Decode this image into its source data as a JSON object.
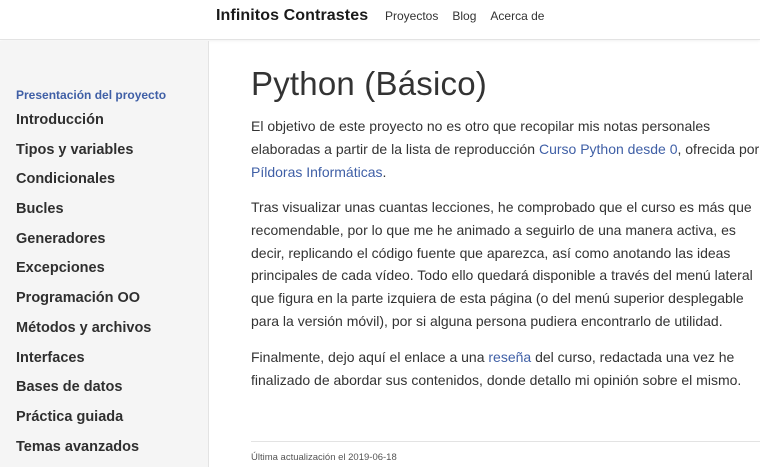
{
  "header": {
    "brand": "Infinitos Contrastes",
    "nav": [
      "Proyectos",
      "Blog",
      "Acerca de"
    ]
  },
  "sidebar": {
    "active_item": "Presentación del proyecto",
    "items": [
      "Introducción",
      "Tipos y variables",
      "Condicionales",
      "Bucles",
      "Generadores",
      "Excepciones",
      "Programación OO",
      "Métodos y archivos",
      "Interfaces",
      "Bases de datos",
      "Práctica guiada",
      "Temas avanzados"
    ]
  },
  "main": {
    "title": "Python (Básico)",
    "p1": {
      "text_before": "El objetivo de este proyecto no es otro que recopilar mis notas personales elaboradas a partir de la lista de reproducción ",
      "link1": "Curso Python desde 0",
      "text_middle": ", ofrecida por ",
      "link2": "Píldoras Informáticas",
      "text_after": "."
    },
    "p2": "Tras visualizar unas cuantas lecciones, he comprobado que el curso es más que recomendable, por lo que me he animado a seguirlo de una manera activa, es decir, replicando el código fuente que aparezca, así como anotando las ideas principales de cada vídeo. Todo ello quedará disponible a través del menú lateral que figura en la parte izquiera de esta página (o del menú superior desplegable para la versión móvil), por si alguna persona pudiera encontrarlo de utilidad.",
    "p3": {
      "text_before": "Finalmente, dejo aquí el enlace a una ",
      "link": "reseña",
      "text_after": " del curso, redactada una vez he finalizado de abordar sus contenidos, donde detallo mi opinión sobre el mismo."
    }
  },
  "footer": {
    "updated": "Última actualización el 2019-06-18"
  },
  "colors": {
    "link": "#3f5fa6",
    "sidebar_bg": "#f5f5f5",
    "text": "#333333"
  }
}
